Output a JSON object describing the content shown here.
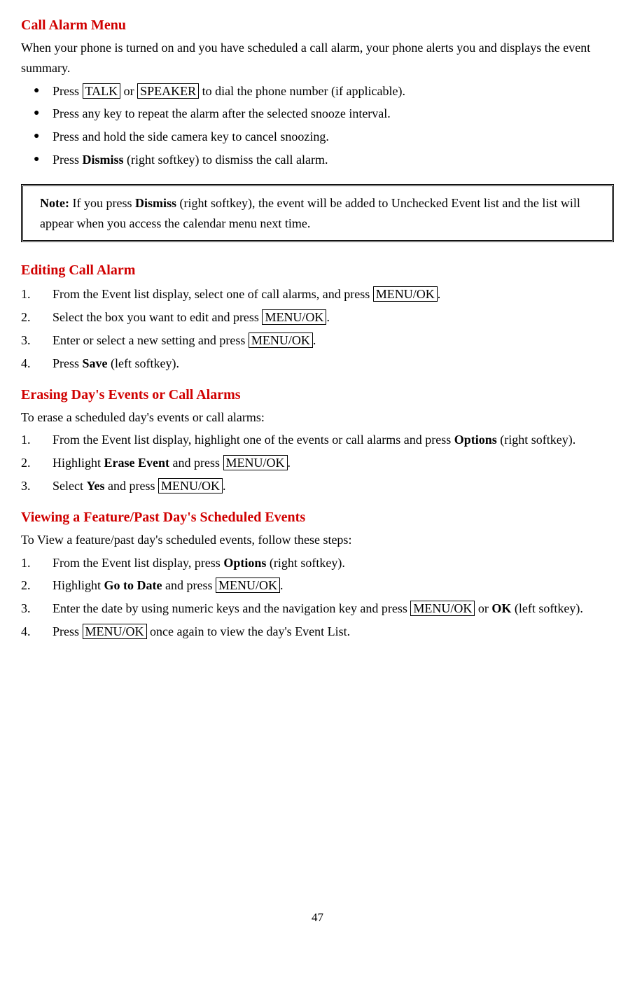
{
  "section1": {
    "title": "Call Alarm Menu",
    "intro": "When your phone is turned on and you have scheduled a call alarm, your phone alerts you and displays the event summary.",
    "bullets": {
      "b1_pre": "Press ",
      "b1_key1": "TALK",
      "b1_mid": " or ",
      "b1_key2": "SPEAKER",
      "b1_post": " to dial the phone number (if applicable).",
      "b2": "Press any key to repeat the alarm after the selected snooze interval.",
      "b3": "Press and hold the side camera key to cancel snoozing.",
      "b4_pre": "Press ",
      "b4_bold": "Dismiss",
      "b4_post": " (right softkey) to dismiss the call alarm."
    }
  },
  "note": {
    "label": "Note:",
    "t1": " If you press ",
    "bold1": "Dismiss",
    "t2": " (right softkey), the event will be added to Unchecked Event list and the list will appear when you access the calendar menu next time."
  },
  "section2": {
    "title": "Editing Call Alarm",
    "s1_pre": "From the Event list display, select one of call alarms, and press ",
    "s1_key": "MENU/OK",
    "s1_post": ".",
    "s2_pre": "Select the box you want to edit and press ",
    "s2_key": "MENU/OK",
    "s2_post": ".",
    "s3_pre": "Enter or select a new setting and press ",
    "s3_key": "MENU/OK",
    "s3_post": ".",
    "s4_pre": "Press ",
    "s4_bold": "Save",
    "s4_post": " (left softkey)."
  },
  "section3": {
    "title": "Erasing Day's Events or Call Alarms",
    "intro": "To erase a scheduled day's events or call alarms:",
    "s1_pre": "From the Event list display, highlight one of the events or call alarms and press ",
    "s1_bold": "Options",
    "s1_post": " (right softkey).",
    "s2_pre": "Highlight ",
    "s2_bold": "Erase Event",
    "s2_mid": " and press ",
    "s2_key": "MENU/OK",
    "s2_post": ".",
    "s3_pre": "Select ",
    "s3_bold": "Yes",
    "s3_mid": " and press ",
    "s3_key": "MENU/OK",
    "s3_post": "."
  },
  "section4": {
    "title": "Viewing a Feature/Past Day's Scheduled Events",
    "intro": "To View a feature/past day's scheduled events, follow these steps:",
    "s1_pre": "From the Event list display, press ",
    "s1_bold": "Options",
    "s1_post": " (right softkey).",
    "s2_pre": "Highlight ",
    "s2_bold": "Go to Date",
    "s2_mid": " and press ",
    "s2_key": "MENU/OK",
    "s2_post": ".",
    "s3_pre": "Enter the date by using numeric keys and the navigation key and press ",
    "s3_key": "MENU/OK",
    "s3_mid": " or ",
    "s3_bold": "OK",
    "s3_post": " (left softkey).",
    "s4_pre": "Press ",
    "s4_key": "MENU/OK",
    "s4_post": " once again to view the day's Event List."
  },
  "pageNumber": "47"
}
